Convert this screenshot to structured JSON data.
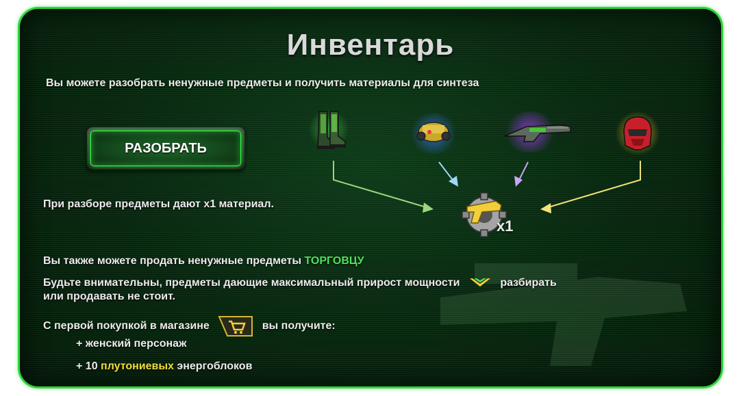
{
  "title": "Инвентарь",
  "intro": "Вы можете разобрать ненужные предметы и получить материалы для синтеза",
  "disassemble_button": "РАЗОБРАТЬ",
  "yield_note": "При разборе предметы дают x1 материал.",
  "material_count": "x1",
  "items": [
    "boots-icon",
    "drone-icon",
    "rifle-icon",
    "helmet-icon"
  ],
  "sell_line": {
    "prefix": "Вы также можете продать ненужные предметы ",
    "highlight": "ТОРГОВЦУ"
  },
  "warning_line1": {
    "before": "Будьте внимательны, предметы дающие максимальный прирост мощности",
    "after": "разбирать"
  },
  "warning_line2": "или продавать не стоит.",
  "purchase_line": {
    "before": "С первой покупкой в магазине",
    "after": "вы получите:"
  },
  "reward1": "+ женский персонаж",
  "reward2": {
    "prefix": "+ 10 ",
    "highlight": "плутониевых",
    "suffix": " энергоблоков"
  },
  "colors": {
    "accent": "#2fd43a",
    "highlight_green": "#4fe25a",
    "highlight_yellow": "#f2de3a"
  }
}
